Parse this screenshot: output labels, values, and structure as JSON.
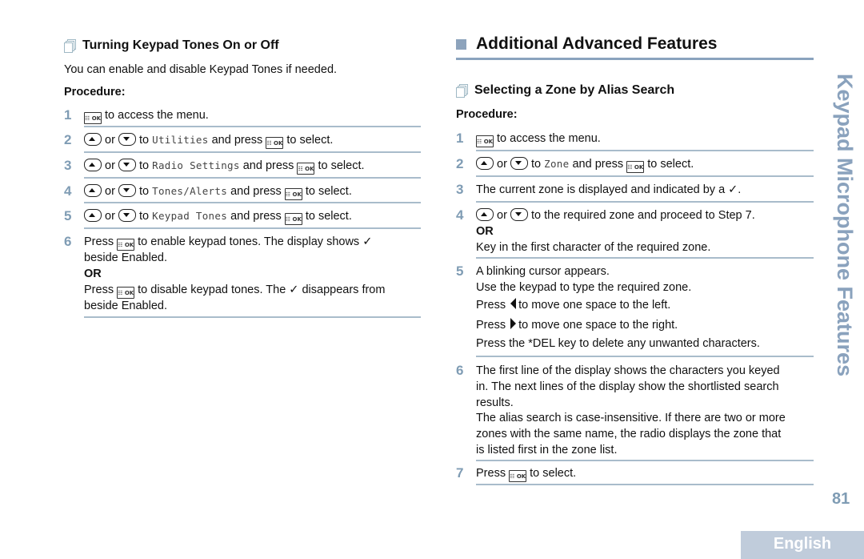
{
  "left_section": {
    "heading": "Turning Keypad Tones On or Off",
    "intro": "You can enable and disable Keypad Tones if needed.",
    "procedure_label": "Procedure:",
    "steps": [
      {
        "number": "1",
        "text": "to access the menu."
      },
      {
        "number": "2",
        "or": "or",
        "to": "to",
        "menu_item": "Utilities",
        "press": "and press",
        "tail": "to select."
      },
      {
        "number": "3",
        "or": "or",
        "to": "to",
        "menu_item": "Radio Settings",
        "press": "and press",
        "tail": "to select."
      },
      {
        "number": "4",
        "or": "or",
        "to": "to",
        "menu_item": "Tones/Alerts",
        "press": "and press",
        "tail": "to select."
      },
      {
        "number": "5",
        "or": "or",
        "to": "to",
        "menu_item": "Keypad Tones",
        "press": "and press",
        "tail": "to select."
      },
      {
        "number": "6",
        "line1_pre": "Press",
        "line1_post": "to enable keypad tones. The display shows ✓",
        "line2": "beside Enabled.",
        "or": "OR",
        "line4_pre": "Press",
        "line4_post": "to disable keypad tones. The ✓ disappears from",
        "line5": "beside Enabled."
      }
    ]
  },
  "right_section": {
    "section_title": "Additional Advanced Features",
    "heading": "Selecting a Zone by Alias Search",
    "procedure_label": "Procedure:",
    "steps": [
      {
        "number": "1",
        "text": "to access the menu."
      },
      {
        "number": "2",
        "or": "or",
        "to": "to",
        "menu_item": "Zone",
        "press": "and press",
        "tail": "to select."
      },
      {
        "number": "3",
        "text": "The current zone is displayed and indicated by a ✓."
      },
      {
        "number": "4",
        "or": "or",
        "text": "to the required zone and proceed to Step 7.",
        "or_label": "OR",
        "alt": "Key in the first character of the required zone."
      },
      {
        "number": "5",
        "line1": "A blinking cursor appears.",
        "line2": "Use the keypad to type the required zone.",
        "line3_pre": "Press",
        "line3_post": "to move one space to the left.",
        "line4_pre": "Press",
        "line4_post": "to move one space to the right.",
        "line5": "Press the *DEL key to delete any unwanted characters."
      },
      {
        "number": "6",
        "lines": [
          "The first line of the display shows the characters you keyed",
          "in. The next lines of the display show the shortlisted search",
          "results.",
          "The alias search is case-insensitive. If there are two or more",
          "zones with the same name, the radio displays the zone that",
          "is listed first in the zone list."
        ]
      },
      {
        "number": "7",
        "pre": "Press",
        "post": "to select."
      }
    ]
  },
  "key_labels": {
    "ok": "☷ OK"
  },
  "side_title": "Keypad Microphone Features",
  "page_number": "81",
  "language_tab": "English"
}
